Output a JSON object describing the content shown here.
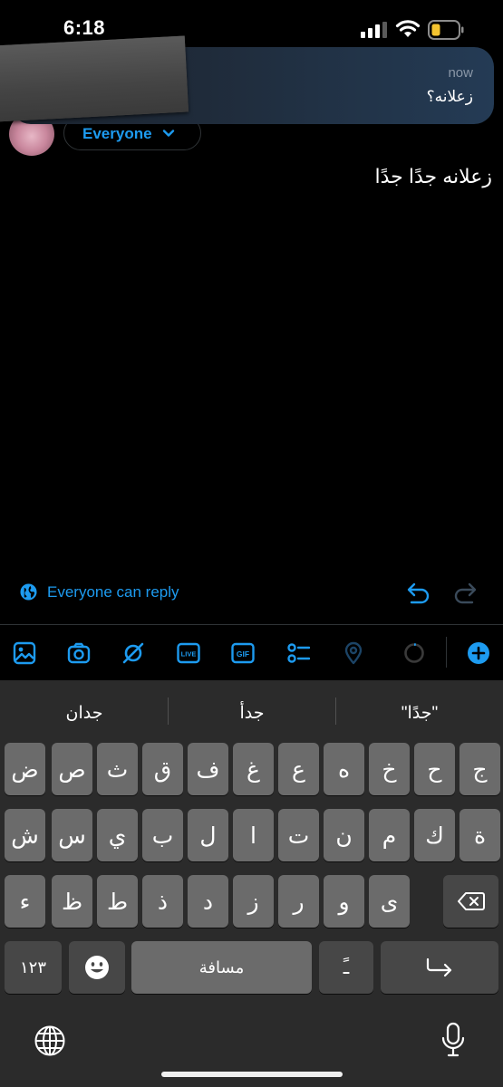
{
  "status_bar": {
    "time": "6:18"
  },
  "notification": {
    "time": "now",
    "message": "زعلانه؟"
  },
  "compose": {
    "audience_label": "Everyone",
    "text": "زعلانه جدًا جدًا",
    "reply_setting": "Everyone can reply"
  },
  "toolbar": {
    "live_label": "LIVE",
    "gif_label": "GIF"
  },
  "keyboard": {
    "suggestions": [
      "جدان",
      "جدأ",
      "\"جدًا\""
    ],
    "row1": [
      "ض",
      "ص",
      "ث",
      "ق",
      "ف",
      "غ",
      "ع",
      "ه",
      "خ",
      "ح",
      "ج"
    ],
    "row2": [
      "ش",
      "س",
      "ي",
      "ب",
      "ل",
      "ا",
      "ت",
      "ن",
      "م",
      "ك",
      "ة"
    ],
    "row3": [
      "ء",
      "ظ",
      "ط",
      "ذ",
      "د",
      "ز",
      "ر",
      "و",
      "ى"
    ],
    "numbers_key": "١٢٣",
    "space_key": "مسافة",
    "diacritic_key": "ـً"
  },
  "colors": {
    "accent": "#1d9bf0",
    "key": "#6b6b6b",
    "key_dark": "#474747",
    "keyboard_bg": "#2b2b2b"
  }
}
